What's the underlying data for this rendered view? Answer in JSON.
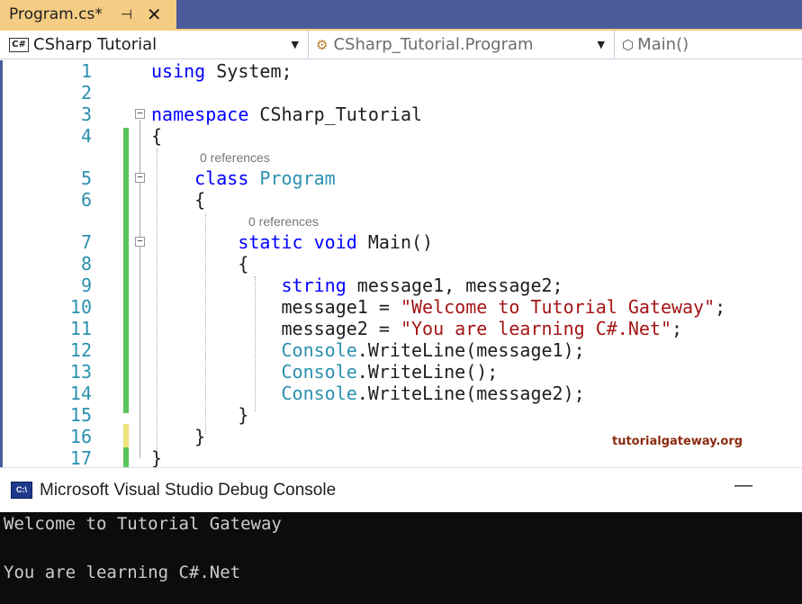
{
  "tab": {
    "title": "Program.cs*",
    "pin_icon": "pin-icon",
    "close_icon": "close-icon"
  },
  "navbar": {
    "project_badge": "C#",
    "project": "CSharp Tutorial",
    "class": "CSharp_Tutorial.Program",
    "member": "Main()"
  },
  "editor": {
    "lines": [
      {
        "n": "1",
        "code": [
          [
            "kw",
            "using "
          ],
          [
            "pl",
            "System;"
          ]
        ]
      },
      {
        "n": "2",
        "code": []
      },
      {
        "n": "3",
        "code": [
          [
            "kw",
            "namespace "
          ],
          [
            "pl",
            "CSharp_Tutorial"
          ]
        ]
      },
      {
        "n": "4",
        "code": [
          [
            "pl",
            "{"
          ]
        ]
      },
      {
        "n": "5",
        "code": [
          [
            "pl",
            "    "
          ],
          [
            "kw",
            "class "
          ],
          [
            "ty",
            "Program"
          ]
        ]
      },
      {
        "n": "6",
        "code": [
          [
            "pl",
            "    {"
          ]
        ]
      },
      {
        "n": "7",
        "code": [
          [
            "pl",
            "        "
          ],
          [
            "kw",
            "static void "
          ],
          [
            "pl",
            "Main()"
          ]
        ]
      },
      {
        "n": "8",
        "code": [
          [
            "pl",
            "        {"
          ]
        ]
      },
      {
        "n": "9",
        "code": [
          [
            "pl",
            "            "
          ],
          [
            "kw",
            "string "
          ],
          [
            "pl",
            "message1, message2;"
          ]
        ]
      },
      {
        "n": "10",
        "code": [
          [
            "pl",
            "            message1 = "
          ],
          [
            "st",
            "\"Welcome to Tutorial Gateway\""
          ],
          [
            "pl",
            ";"
          ]
        ]
      },
      {
        "n": "11",
        "code": [
          [
            "pl",
            "            message2 = "
          ],
          [
            "st",
            "\"You are learning C#.Net\""
          ],
          [
            "pl",
            ";"
          ]
        ]
      },
      {
        "n": "12",
        "code": [
          [
            "pl",
            "            "
          ],
          [
            "ty",
            "Console"
          ],
          [
            "pl",
            ".WriteLine(message1);"
          ]
        ]
      },
      {
        "n": "13",
        "code": [
          [
            "pl",
            "            "
          ],
          [
            "ty",
            "Console"
          ],
          [
            "pl",
            ".WriteLine();"
          ]
        ]
      },
      {
        "n": "14",
        "code": [
          [
            "pl",
            "            "
          ],
          [
            "ty",
            "Console"
          ],
          [
            "pl",
            ".WriteLine(message2);"
          ]
        ]
      },
      {
        "n": "15",
        "code": [
          [
            "pl",
            "        }"
          ]
        ]
      },
      {
        "n": "16",
        "code": [
          [
            "pl",
            "    }"
          ]
        ]
      },
      {
        "n": "17",
        "code": [
          [
            "pl",
            "}"
          ]
        ]
      }
    ],
    "references_label": "0 references",
    "watermark": "tutorialgateway.org"
  },
  "console": {
    "title": "Microsoft Visual Studio Debug Console",
    "minimize": "—",
    "output": [
      "Welcome to Tutorial Gateway",
      "",
      "You are learning C#.Net"
    ]
  },
  "colors": {
    "keyword": "#0000ff",
    "type": "#2b91af",
    "string": "#a31515",
    "tab_active": "#f5cc84",
    "tab_strip": "#4c5c9a"
  }
}
